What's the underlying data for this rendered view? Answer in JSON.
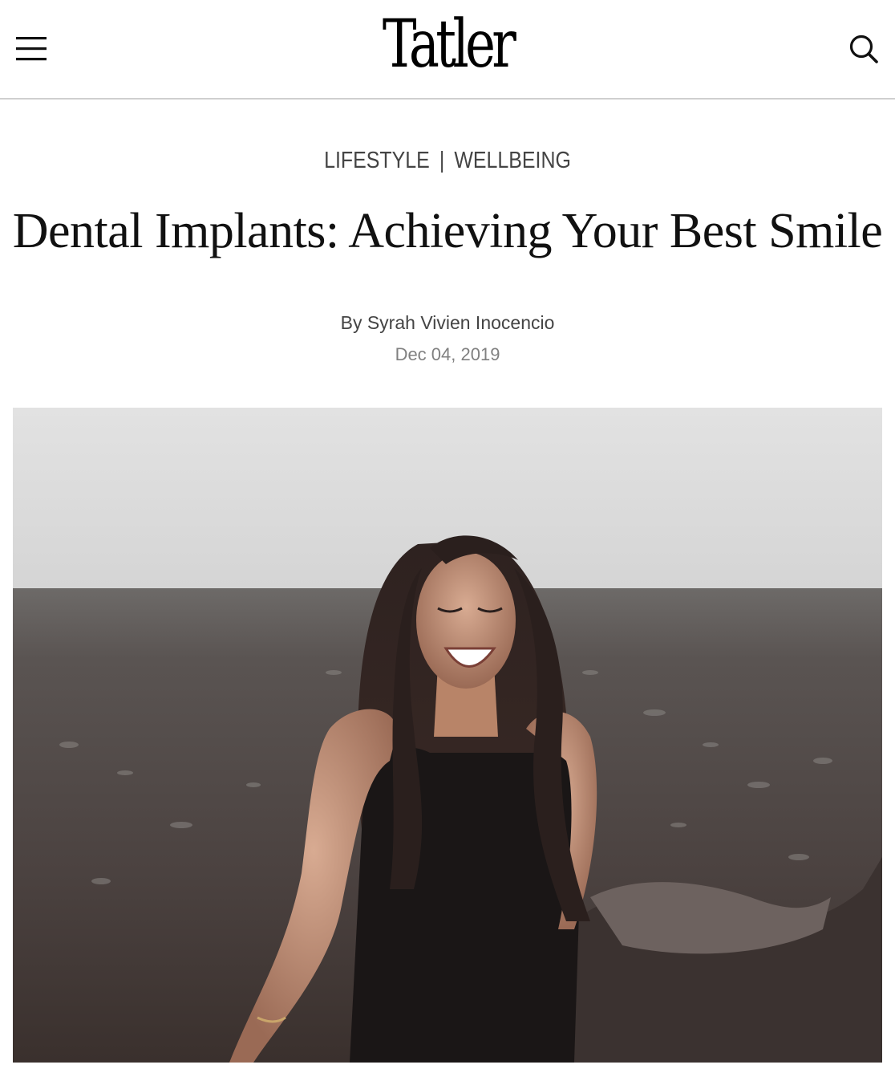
{
  "header": {
    "logo_text": "Tatler",
    "menu_icon": "hamburger-menu-icon",
    "search_icon": "search-icon"
  },
  "article": {
    "categories": [
      "LIFESTYLE",
      "WELLBEING"
    ],
    "separator": "|",
    "title": "Dental Implants: Achieving Your Best Smile",
    "byline": "By Syrah Vivien Inocencio",
    "date": "Dec 04, 2019"
  },
  "hero_image": {
    "subject": "woman-laughing-photo"
  },
  "colors": {
    "text": "#111111",
    "muted": "#808080",
    "category": "#444444",
    "divider": "#cfcfcf"
  }
}
